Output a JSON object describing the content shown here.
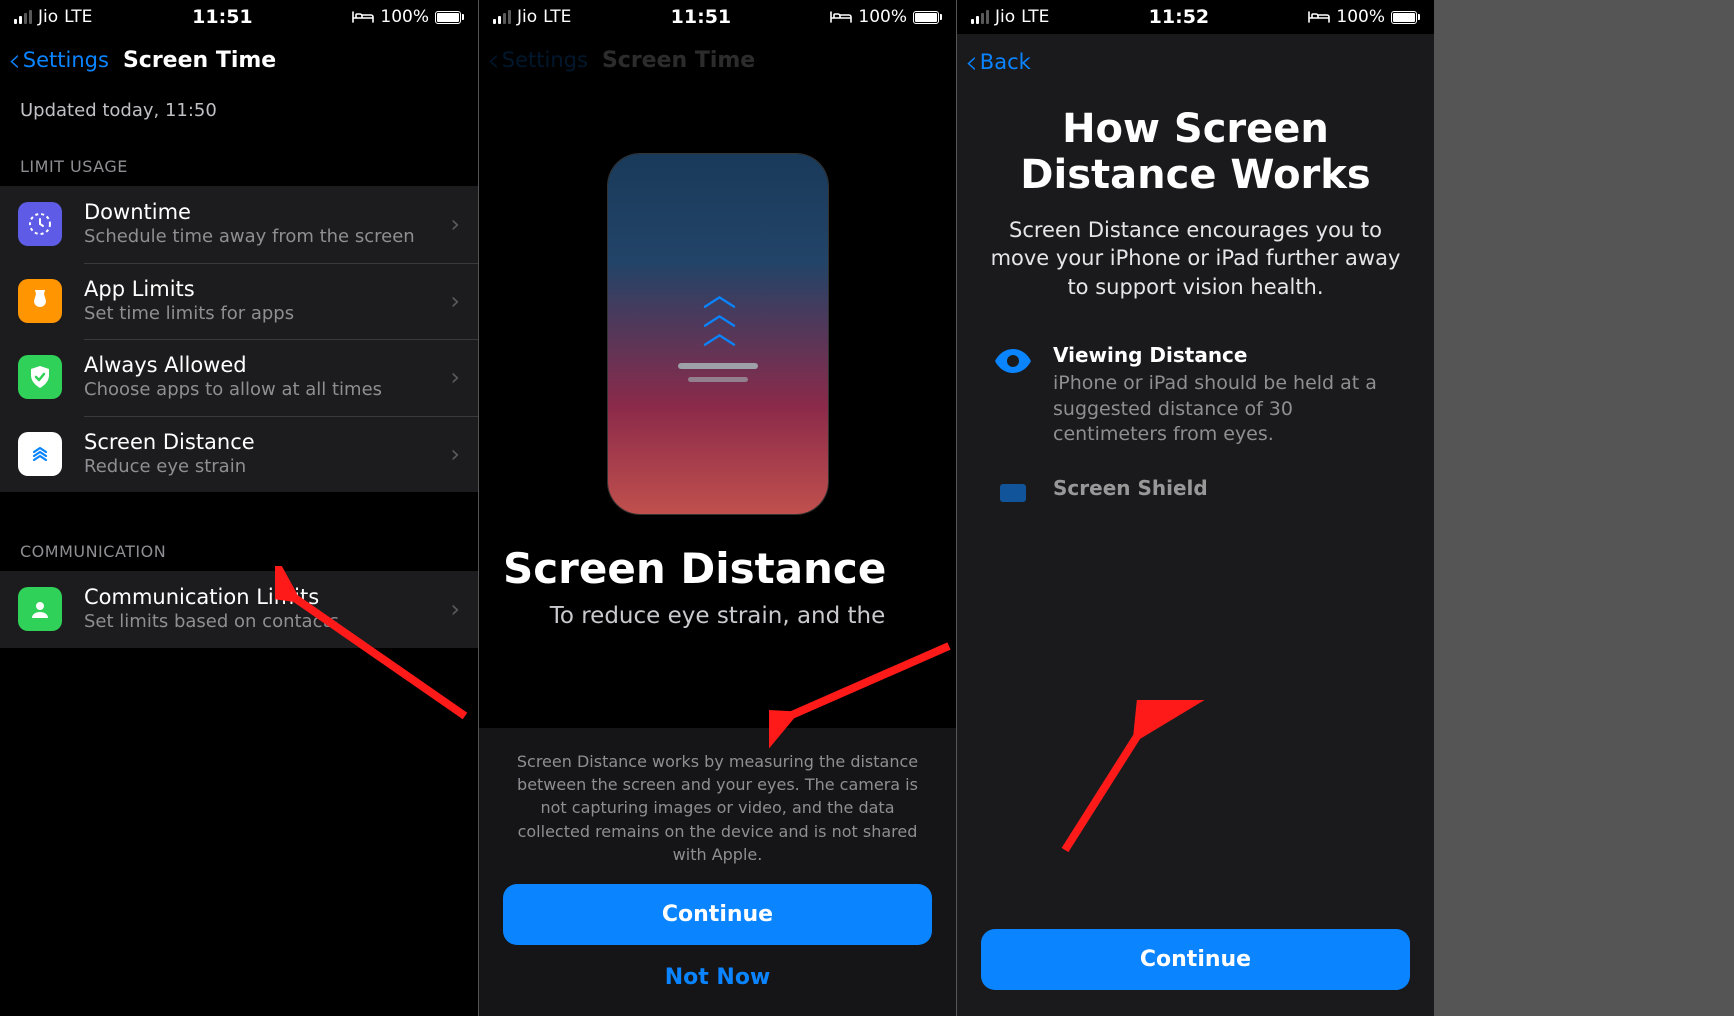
{
  "status": {
    "carrier": "Jio",
    "network": "LTE",
    "battery_pct": "100%",
    "time_s1": "11:51",
    "time_s2": "11:51",
    "time_s3": "11:52"
  },
  "screen1": {
    "back_label": "Settings",
    "title": "Screen Time",
    "updated": "Updated today, 11:50",
    "sections": {
      "limit_header": "LIMIT USAGE",
      "comm_header": "COMMUNICATION"
    },
    "items": {
      "downtime": {
        "title": "Downtime",
        "sub": "Schedule time away from the screen"
      },
      "app_limits": {
        "title": "App Limits",
        "sub": "Set time limits for apps"
      },
      "always_allowed": {
        "title": "Always Allowed",
        "sub": "Choose apps to allow at all times"
      },
      "screen_distance": {
        "title": "Screen Distance",
        "sub": "Reduce eye strain"
      },
      "comm_limits": {
        "title": "Communication Limits",
        "sub": "Set limits based on contacts"
      }
    }
  },
  "screen2": {
    "nav_back": "Settings",
    "nav_title": "Screen Time",
    "hero_title": "Screen Distance",
    "hero_sub": "To reduce eye strain, and the",
    "fine": "Screen Distance works by measuring the distance between the screen and your eyes. The camera is not capturing images or video, and the data collected remains on the device and is not shared with Apple.",
    "continue": "Continue",
    "not_now": "Not Now"
  },
  "screen3": {
    "back": "Back",
    "title": "How Screen Distance Works",
    "lead": "Screen Distance encourages you to move your iPhone or iPad further away to support vision health.",
    "feat1": {
      "title": "Viewing Distance",
      "body": "iPhone or iPad should be held at a suggested distance of 30 centimeters from eyes."
    },
    "feat2": {
      "title": "Screen Shield"
    },
    "continue": "Continue"
  }
}
